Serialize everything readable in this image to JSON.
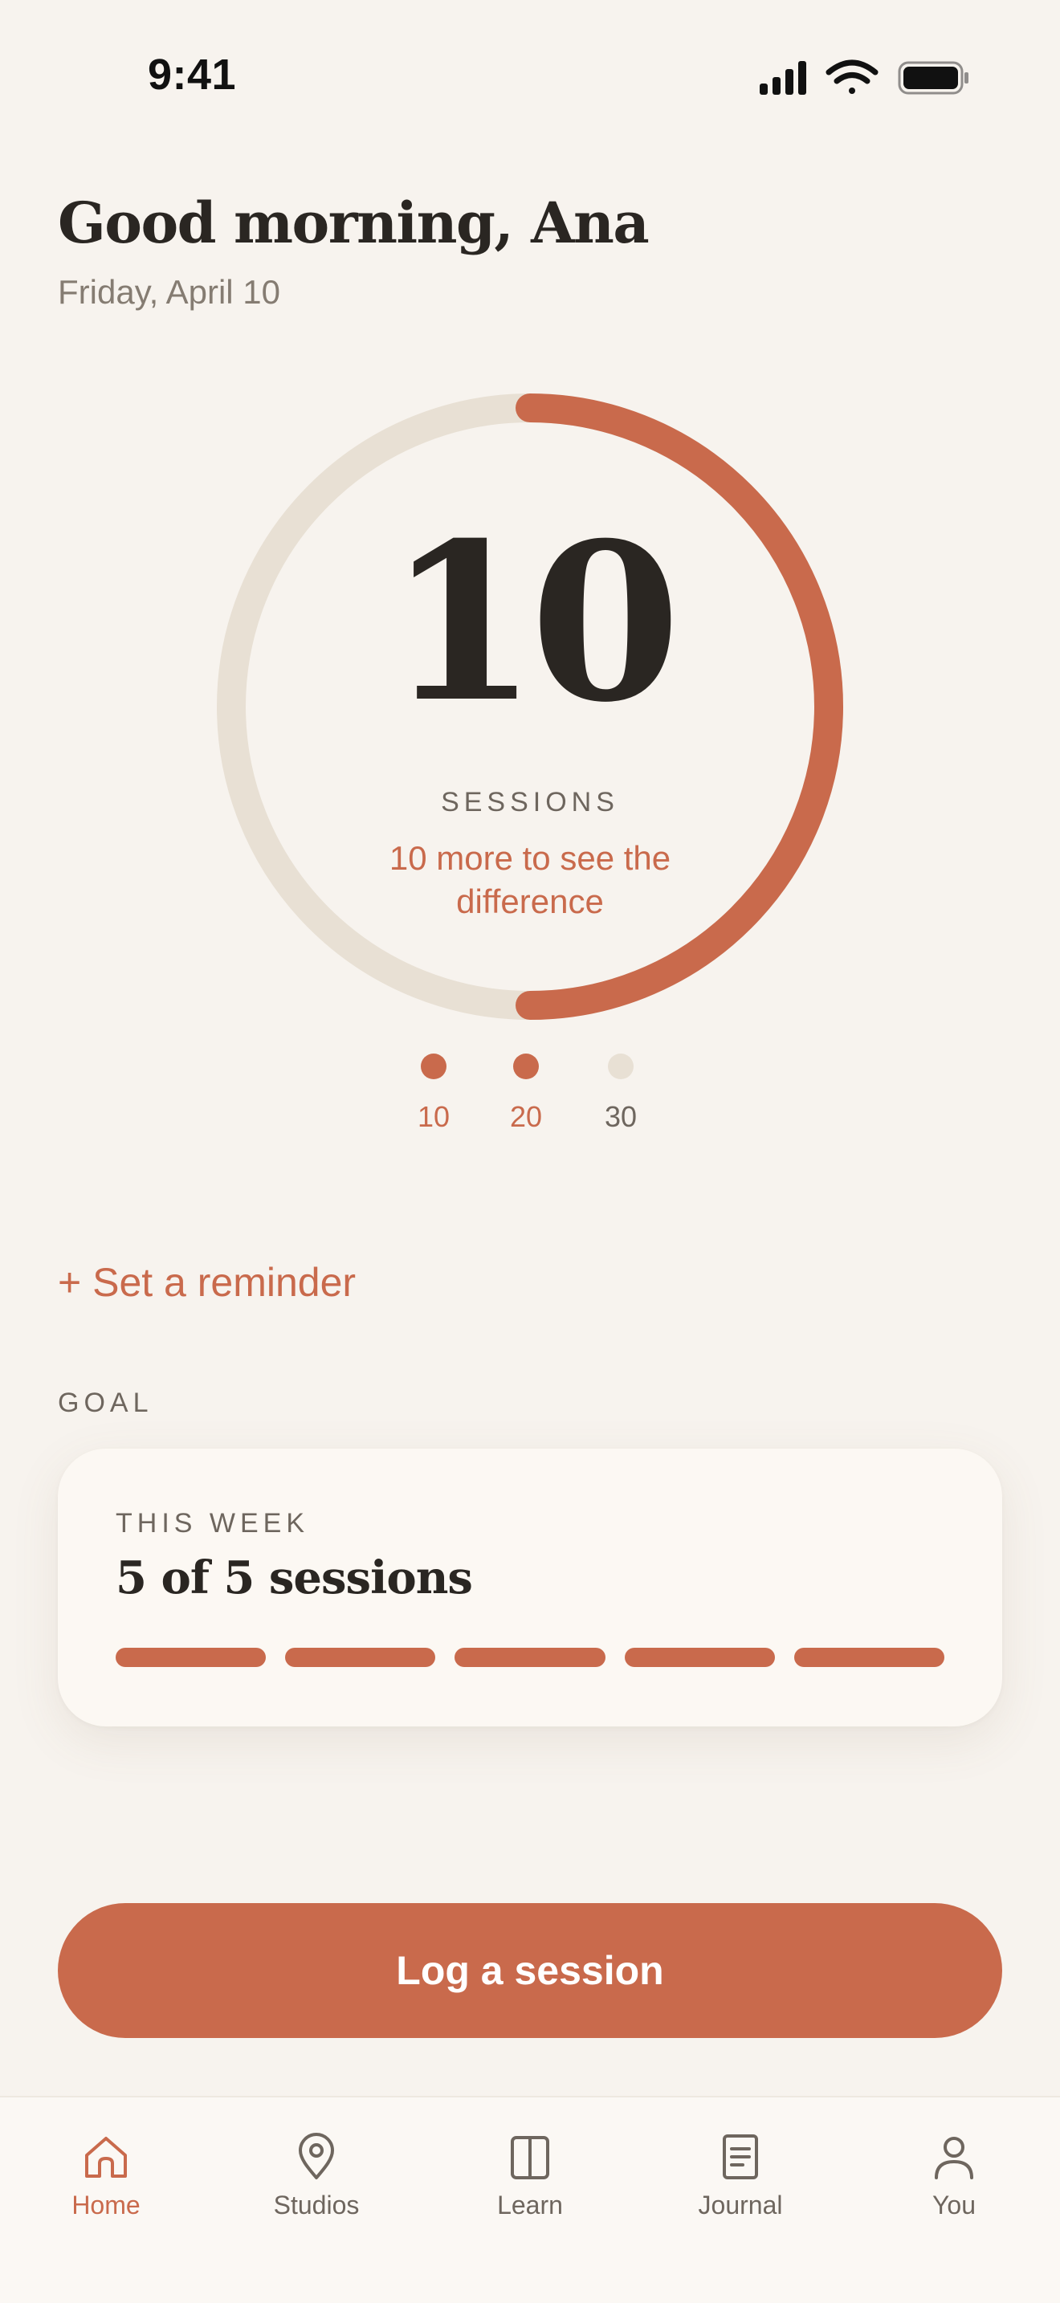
{
  "status_bar": {
    "time": "9:41"
  },
  "header": {
    "greeting": "Good morning, Ana",
    "date": "Friday, April 10"
  },
  "progress": {
    "sessions": "10",
    "label": "SESSIONS",
    "subtext": "10 more to see the difference",
    "fraction": 0.5,
    "milestones": [
      {
        "label": "10",
        "reached": true
      },
      {
        "label": "20",
        "reached": true
      },
      {
        "label": "30",
        "reached": false
      }
    ]
  },
  "reminder": {
    "label": "+ Set a reminder"
  },
  "goal": {
    "section_label": "GOAL",
    "period": "THIS WEEK",
    "summary": "5 of 5 sessions",
    "completed": 5,
    "total": 5
  },
  "primary_action": {
    "label": "Log a session"
  },
  "tabbar": {
    "items": [
      {
        "label": "Home",
        "icon": "home-icon",
        "active": true
      },
      {
        "label": "Studios",
        "icon": "location-pin-icon",
        "active": false
      },
      {
        "label": "Learn",
        "icon": "book-icon",
        "active": false
      },
      {
        "label": "Journal",
        "icon": "journal-icon",
        "active": false
      },
      {
        "label": "You",
        "icon": "person-icon",
        "active": false
      }
    ]
  },
  "colors": {
    "accent": "#C96A4C",
    "track": "#E8E0D4",
    "background": "#F7F3EE",
    "text": "#2A2622",
    "muted": "#6E665E",
    "inactive_tab": "#6E665E"
  }
}
